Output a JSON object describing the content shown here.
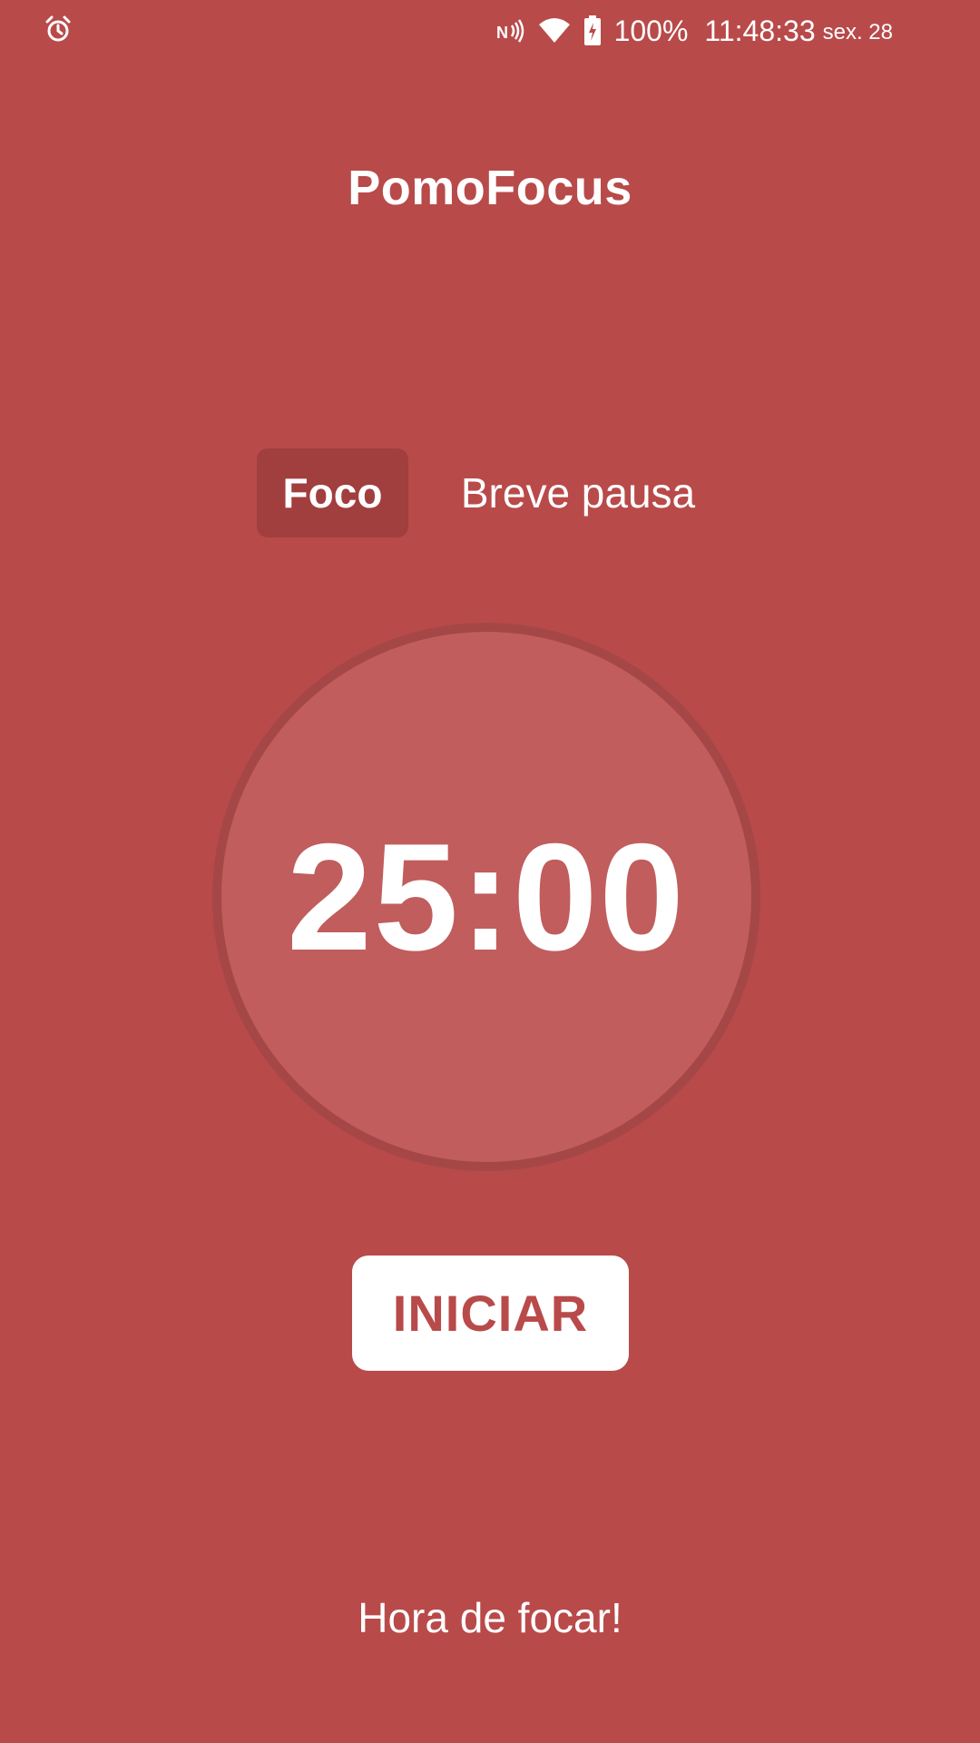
{
  "status_bar": {
    "left_icon": "alarm-icon",
    "icons": [
      "nfc-icon",
      "wifi-icon",
      "battery-charging-icon"
    ],
    "battery": "100%",
    "time": "11:48:33",
    "date": "sex. 28"
  },
  "app": {
    "title": "PomoFocus"
  },
  "tabs": [
    {
      "label": "Foco",
      "active": true
    },
    {
      "label": "Breve pausa",
      "active": false
    }
  ],
  "timer": {
    "display": "25:00"
  },
  "controls": {
    "start_label": "INICIAR"
  },
  "footer": {
    "message": "Hora de focar!"
  },
  "colors": {
    "background": "#B94A4A",
    "active_tab": "#A13E3E",
    "timer_fill": "#C15D5D",
    "timer_ring": "#A54747",
    "button_bg": "#FFFFFF",
    "button_text": "#B94A4A",
    "text": "#FFFFFF"
  }
}
